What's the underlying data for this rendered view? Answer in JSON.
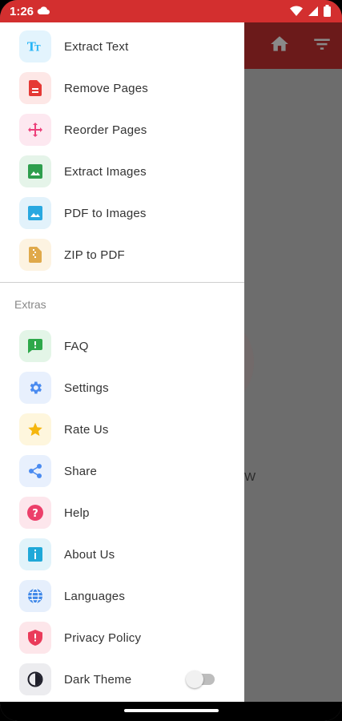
{
  "status_bar": {
    "time": "1:26",
    "bg": "#d32f2f"
  },
  "background": {
    "partial_text": "W"
  },
  "drawer": {
    "tools": [
      {
        "name": "extract-text",
        "label": "Extract Text",
        "icon": "text-format-icon",
        "color": "#29b6f6",
        "bg": "#e3f4fd"
      },
      {
        "name": "remove-pages",
        "label": "Remove Pages",
        "icon": "file-remove-icon",
        "color": "#e53935",
        "bg": "#fde7e6"
      },
      {
        "name": "reorder-pages",
        "label": "Reorder Pages",
        "icon": "move-arrows-icon",
        "color": "#ec407a",
        "bg": "#fde8f0"
      },
      {
        "name": "extract-images",
        "label": "Extract Images",
        "icon": "image-icon",
        "color": "#2e9e4d",
        "bg": "#e5f4e9"
      },
      {
        "name": "pdf-to-images",
        "label": "PDF to Images",
        "icon": "photo-icon",
        "color": "#29a8e0",
        "bg": "#e2f2fb"
      },
      {
        "name": "zip-to-pdf",
        "label": "ZIP to PDF",
        "icon": "zip-file-icon",
        "color": "#e0a94a",
        "bg": "#fdf3e1"
      }
    ],
    "section_title": "Extras",
    "extras": [
      {
        "name": "faq",
        "label": "FAQ",
        "icon": "faq-chat-icon",
        "color": "#2ea84a",
        "bg": "#e3f5e7"
      },
      {
        "name": "settings",
        "label": "Settings",
        "icon": "gear-icon",
        "color": "#4a8bf0",
        "bg": "#e8f0fd"
      },
      {
        "name": "rate-us",
        "label": "Rate Us",
        "icon": "star-icon",
        "color": "#f5b60d",
        "bg": "#fef6dd"
      },
      {
        "name": "share",
        "label": "Share",
        "icon": "share-icon",
        "color": "#4a8bf0",
        "bg": "#e8f0fd"
      },
      {
        "name": "help",
        "label": "Help",
        "icon": "help-circle-icon",
        "color": "#ec3f6a",
        "bg": "#fde6ec"
      },
      {
        "name": "about-us",
        "label": "About Us",
        "icon": "info-icon",
        "color": "#1fa8d8",
        "bg": "#e1f3fa"
      },
      {
        "name": "languages",
        "label": "Languages",
        "icon": "globe-icon",
        "color": "#3d86e8",
        "bg": "#e6effc"
      },
      {
        "name": "privacy-policy",
        "label": "Privacy Policy",
        "icon": "shield-icon",
        "color": "#ea3b5a",
        "bg": "#fde6ea"
      },
      {
        "name": "dark-theme",
        "label": "Dark Theme",
        "icon": "contrast-icon",
        "color": "#3a3a4a",
        "bg": "#ececef",
        "toggle": false
      }
    ]
  }
}
